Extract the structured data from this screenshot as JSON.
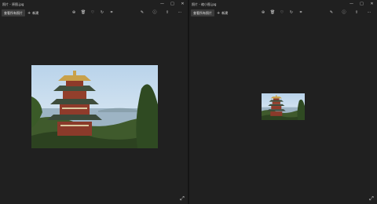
{
  "panes": [
    {
      "title": "照片 - 原图.jpg",
      "toolbar": {
        "first_label": "查看所有照片",
        "second_label": "新建"
      },
      "window_controls": [
        "—",
        "□",
        "✕"
      ]
    },
    {
      "title": "照片 - 缩小图.jpg",
      "toolbar": {
        "first_label": "查看所有照片",
        "second_label": "新建"
      },
      "window_controls": [
        "—",
        "□",
        "✕"
      ]
    }
  ],
  "icons": {
    "add": "+",
    "zoom_in": "⊕",
    "delete": "🗑",
    "favorite": "♡",
    "rotate": "↻",
    "crop": "⌗",
    "edit": "✎",
    "share": "⇪",
    "more": "⋯",
    "info": "ⓘ",
    "expand": "⤢"
  }
}
